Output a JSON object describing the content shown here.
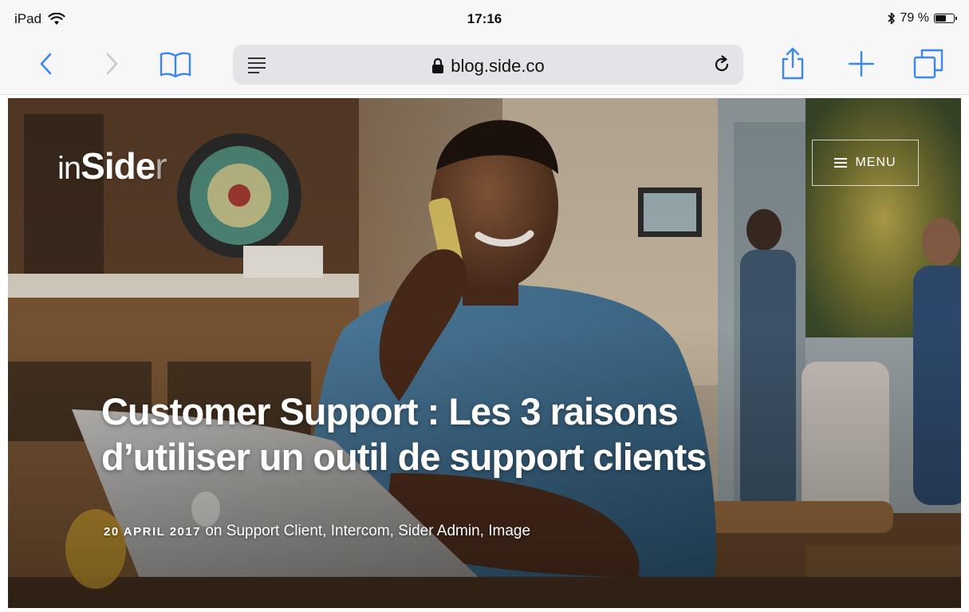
{
  "status_bar": {
    "device": "iPad",
    "time": "17:16",
    "battery": "79 %",
    "battery_level": 0.79
  },
  "toolbar": {
    "url": "blog.side.co",
    "icons": [
      "back-icon",
      "forward-icon",
      "bookmarks-icon",
      "reader-icon",
      "lock-icon",
      "reload-icon",
      "share-icon",
      "new-tab-icon",
      "tabs-icon"
    ]
  },
  "hero": {
    "logo": {
      "prefix": "in",
      "brand": "Side",
      "suffix": "r"
    },
    "menu_label": "MENU",
    "title_line1": "Customer Support : Les 3 raisons",
    "title_line2": "d’utiliser un outil de support clients",
    "date": "20 APRIL 2017",
    "on_word": "on",
    "tags": [
      "Support Client",
      "Intercom",
      "Sider Admin",
      "Image"
    ]
  },
  "colors": {
    "browser_chrome": "#f7f7f7",
    "address_bar": "#e4e4e8",
    "ios_blue": "#3b86f0",
    "hero_text": "#ffffff"
  }
}
